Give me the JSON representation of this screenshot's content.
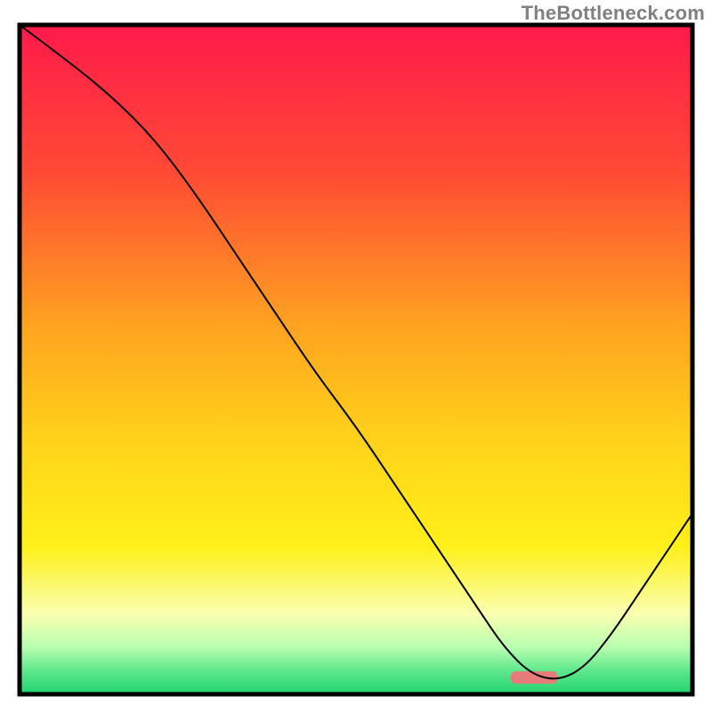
{
  "watermark": "TheBottleneck.com",
  "chart_data": {
    "type": "line",
    "title": "",
    "xlabel": "",
    "ylabel": "",
    "xlim": [
      0,
      100
    ],
    "ylim": [
      0,
      100
    ],
    "grid": false,
    "legend": false,
    "annotations": [],
    "background_gradient_stops": [
      {
        "pos": 0.0,
        "color": "#ff1a4b"
      },
      {
        "pos": 0.22,
        "color": "#ff4a34"
      },
      {
        "pos": 0.45,
        "color": "#ffa320"
      },
      {
        "pos": 0.62,
        "color": "#ffd21a"
      },
      {
        "pos": 0.78,
        "color": "#fff01a"
      },
      {
        "pos": 0.88,
        "color": "#faffb0"
      },
      {
        "pos": 0.93,
        "color": "#b8ffb0"
      },
      {
        "pos": 0.965,
        "color": "#5ee78c"
      },
      {
        "pos": 1.0,
        "color": "#22d36f"
      }
    ],
    "optimal_marker": {
      "x_start": 73,
      "x_end": 80,
      "y": 2.5,
      "color": "#e77a7a"
    },
    "series": [
      {
        "name": "bottleneck-curve",
        "color": "#000000",
        "stroke_width": 2,
        "x": [
          0,
          8,
          14,
          20,
          26,
          32,
          38,
          44,
          50,
          56,
          62,
          68,
          72,
          76,
          80,
          84,
          88,
          92,
          96,
          100
        ],
        "y": [
          100,
          94,
          89,
          83,
          75,
          66,
          57,
          48,
          40,
          31,
          22,
          13,
          7,
          3,
          2,
          4,
          9,
          15,
          21,
          27
        ]
      }
    ]
  }
}
